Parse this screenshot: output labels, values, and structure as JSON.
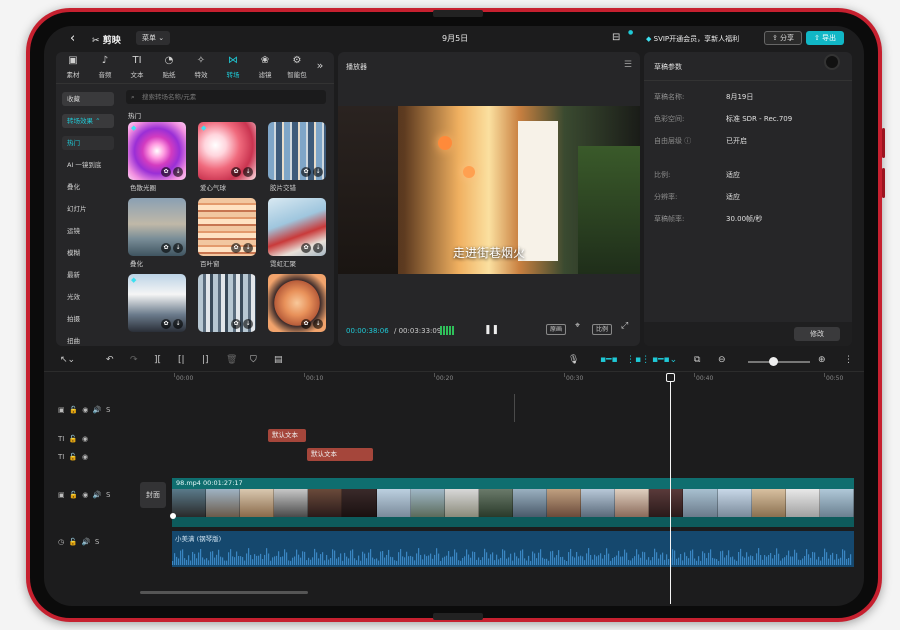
{
  "topbar": {
    "back_icon": "‹",
    "app_name": "剪映",
    "menu_label": "菜单",
    "date": "9月5日",
    "svip_text": "SVIP开通会员，享新人福利",
    "share_label": "分享",
    "export_label": "导出"
  },
  "toolbar_tabs": [
    {
      "label": "素材",
      "icon": "▣"
    },
    {
      "label": "音频",
      "icon": "♪"
    },
    {
      "label": "文本",
      "icon": "TI"
    },
    {
      "label": "贴纸",
      "icon": "◔"
    },
    {
      "label": "特效",
      "icon": "✧"
    },
    {
      "label": "转场",
      "icon": "⋈"
    },
    {
      "label": "滤镜",
      "icon": "❀"
    },
    {
      "label": "智能包",
      "icon": "⚙"
    }
  ],
  "categories": {
    "favorites": "收藏",
    "transition_effects": "转场效果",
    "items": [
      "热门",
      "AI 一镜到底",
      "叠化",
      "幻灯片",
      "运镜",
      "模糊",
      "最新",
      "光效",
      "拍摄",
      "扭曲"
    ]
  },
  "search": {
    "placeholder": "搜索转场名称/元素"
  },
  "hot_section_title": "热门",
  "thumbnails": [
    {
      "label": "色散光圈"
    },
    {
      "label": "爱心气球"
    },
    {
      "label": "胶片交错"
    },
    {
      "label": "叠化"
    },
    {
      "label": "百叶窗"
    },
    {
      "label": "霓虹汇聚"
    },
    {
      "label": ""
    },
    {
      "label": ""
    },
    {
      "label": ""
    }
  ],
  "player": {
    "title": "播放器",
    "caption": "走进街巷烟火",
    "current_time": "00:00:38:06",
    "total_time": "00:03:33:09",
    "original_label": "原画",
    "ratio_label": "比例"
  },
  "params": {
    "title": "草稿参数",
    "rows": [
      {
        "label": "草稿名称:",
        "value": "8月19日"
      },
      {
        "label": "色彩空间:",
        "value": "标准 SDR - Rec.709"
      },
      {
        "label": "自由层级",
        "value": "已开启"
      },
      {
        "label": "比例:",
        "value": "适应"
      },
      {
        "label": "分辨率:",
        "value": "适应"
      },
      {
        "label": "草稿帧率:",
        "value": "30.00帧/秒"
      }
    ],
    "modify_label": "修改"
  },
  "timeline": {
    "ruler": [
      "00:00",
      "00:10",
      "00:20",
      "00:30",
      "00:40",
      "00:50"
    ],
    "cover_label": "封面",
    "text_clip_1": "默认文本",
    "text_clip_2": "默认文本",
    "video_clip": "98.mp4  00:01:27:17",
    "audio_clip": "小美满 (钢琴版)"
  },
  "colors": {
    "accent": "#1fc9d6",
    "device_frame": "#c6202f",
    "text_clip": "#a5463b",
    "video_track": "#0f6e6f",
    "audio_track": "#15486e"
  }
}
